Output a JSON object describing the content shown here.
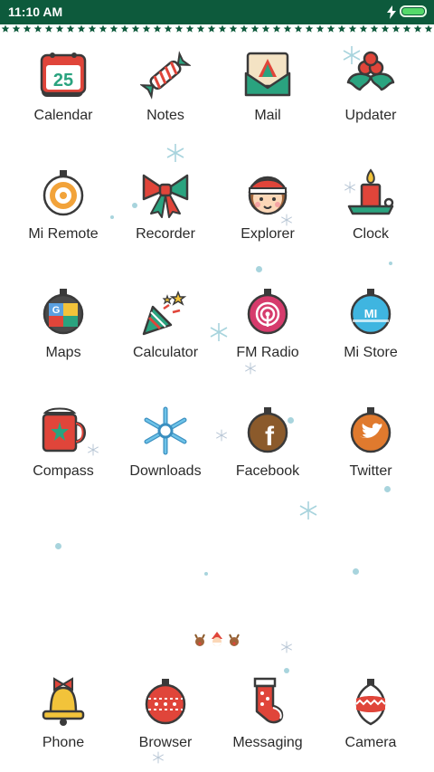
{
  "status_bar": {
    "time": "11:10 AM",
    "battery_icon": "battery-full-icon",
    "charging_icon": "charging-bolt-icon"
  },
  "home_grid": [
    {
      "label": "Calendar",
      "icon": "calendar-icon",
      "date": "25"
    },
    {
      "label": "Notes",
      "icon": "candy-icon"
    },
    {
      "label": "Mail",
      "icon": "envelope-tree-icon"
    },
    {
      "label": "Updater",
      "icon": "holly-icon"
    },
    {
      "label": "Mi Remote",
      "icon": "ornament-icon"
    },
    {
      "label": "Recorder",
      "icon": "bow-icon"
    },
    {
      "label": "Explorer",
      "icon": "elf-face-icon"
    },
    {
      "label": "Clock",
      "icon": "candle-icon"
    },
    {
      "label": "Maps",
      "icon": "maps-ornament-icon"
    },
    {
      "label": "Calculator",
      "icon": "party-popper-icon"
    },
    {
      "label": "FM Radio",
      "icon": "radio-ornament-icon"
    },
    {
      "label": "Mi Store",
      "icon": "mi-ornament-icon",
      "badge": "MI"
    },
    {
      "label": "Compass",
      "icon": "mug-icon"
    },
    {
      "label": "Downloads",
      "icon": "snowflake-icon"
    },
    {
      "label": "Facebook",
      "icon": "facebook-ornament-icon",
      "badge": "f"
    },
    {
      "label": "Twitter",
      "icon": "twitter-ornament-icon"
    }
  ],
  "dock": [
    {
      "label": "Phone",
      "icon": "bell-icon"
    },
    {
      "label": "Browser",
      "icon": "red-ornament-icon"
    },
    {
      "label": "Messaging",
      "icon": "stocking-icon"
    },
    {
      "label": "Camera",
      "icon": "bauble-icon"
    }
  ],
  "page_indicator_icon": "reindeer-santa-indicator-icon",
  "colors": {
    "status_bar": "#0d5a3c",
    "battery": "#54d96a",
    "label": "#2b2b2b",
    "red": "#e0453a",
    "green": "#2aa37f"
  }
}
